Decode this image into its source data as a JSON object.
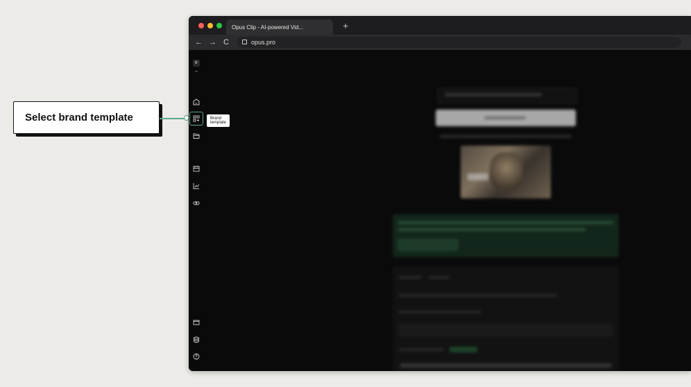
{
  "callout": {
    "text": "Select brand template"
  },
  "browser": {
    "tab_title": "Opus Clip - AI-powered Vid...",
    "new_tab_symbol": "+",
    "nav": {
      "back": "←",
      "forward": "→",
      "reload": "C"
    },
    "url": "opus.pro",
    "traffic_lights": [
      "#ff5f57",
      "#febc2e",
      "#28c840"
    ]
  },
  "sidebar": {
    "workspace_initial": "e",
    "workspace_chevron": "⌄",
    "icons": [
      "home-icon",
      "brand-template-icon",
      "folder-icon",
      "calendar-icon",
      "analytics-icon",
      "link-icon",
      "inbox-icon",
      "database-icon",
      "help-icon"
    ],
    "tooltip": "Brand template"
  },
  "colors": {
    "accent": "#5aa98a",
    "background": "#ecebe7",
    "app_bg": "#0a0a0a"
  }
}
